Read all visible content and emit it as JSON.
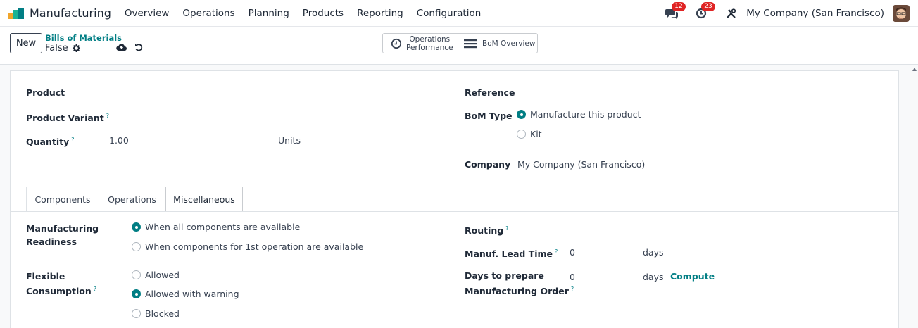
{
  "navbar": {
    "app_title": "Manufacturing",
    "menu": [
      "Overview",
      "Operations",
      "Planning",
      "Products",
      "Reporting",
      "Configuration"
    ],
    "messages_count": "12",
    "activities_count": "23",
    "company": "My Company (San Francisco)"
  },
  "control": {
    "new_label": "New",
    "breadcrumb": "Bills of Materials",
    "record_name": "False",
    "ops_perf_line1": "Operations",
    "ops_perf_line2": "Performance",
    "bom_overview": "BoM Overview"
  },
  "form": {
    "product_label": "Product",
    "variant_label": "Product Variant",
    "quantity_label": "Quantity",
    "quantity_value": "1.00",
    "uom_value": "Units",
    "reference_label": "Reference",
    "bom_type_label": "BoM Type",
    "bom_type_options": [
      "Manufacture this product",
      "Kit"
    ],
    "company_label": "Company",
    "company_value": "My Company (San Francisco)",
    "help_mark": "?"
  },
  "tabs": [
    "Components",
    "Operations",
    "Miscellaneous"
  ],
  "misc": {
    "readiness_label_1": "Manufacturing",
    "readiness_label_2": "Readiness",
    "readiness_options": [
      "When all components are available",
      "When components for 1st operation are available"
    ],
    "flex_label_1": "Flexible",
    "flex_label_2": "Consumption",
    "flex_options": [
      "Allowed",
      "Allowed with warning",
      "Blocked"
    ],
    "routing_label": "Routing",
    "lead_time_label": "Manuf. Lead Time",
    "lead_time_value": "0",
    "lead_time_unit": "days",
    "days_prepare_label_1": "Days to prepare",
    "days_prepare_label_2": "Manufacturing Order",
    "days_prepare_value": "0",
    "days_prepare_unit": "days",
    "compute_label": "Compute"
  },
  "colors": {
    "accent": "#017e84",
    "badge": "#e02424"
  }
}
